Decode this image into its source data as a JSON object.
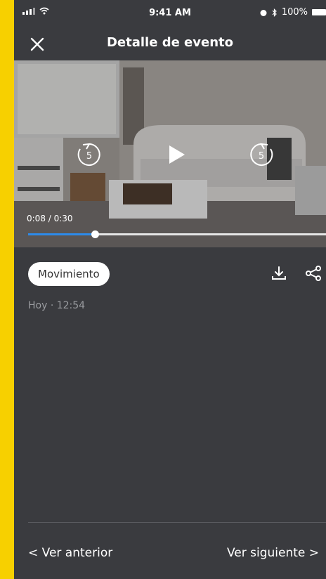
{
  "status_bar": {
    "time": "9:41 AM",
    "battery": "100%"
  },
  "header": {
    "title": "Detalle de evento",
    "close_icon": "close-icon"
  },
  "video": {
    "time_display": "0:08 / 0:30",
    "progress": 0.225,
    "controls": {
      "rewind_seconds": "5",
      "forward_seconds": "5"
    }
  },
  "event": {
    "tag": "Movimiento",
    "timestamp": "Hoy · 12:54",
    "actions": [
      "download-icon",
      "share-icon"
    ]
  },
  "footer": {
    "prev_label": "< Ver anterior",
    "next_label": "Ver siguiente >"
  },
  "colors": {
    "page_bg": "#F7D000",
    "app_bg": "#3A3B3F",
    "accent": "#2D8BEA"
  }
}
